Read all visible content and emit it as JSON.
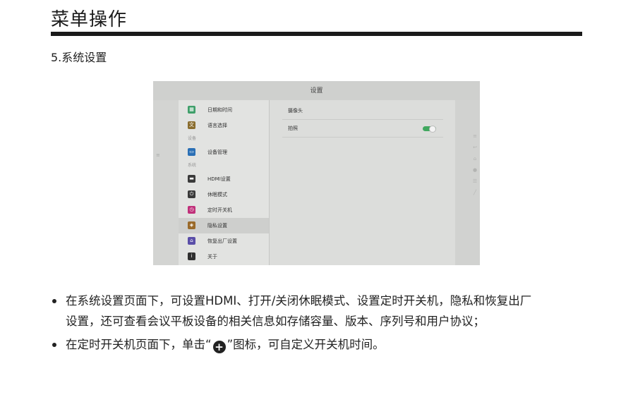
{
  "header": {
    "title": "菜单操作"
  },
  "section": {
    "title": "5.系统设置"
  },
  "screenshot": {
    "window_title": "设置",
    "menu": {
      "items": [
        {
          "label": "日期和时间",
          "icon": "calendar-icon",
          "color": "#3f9f6a"
        },
        {
          "label": "语言选择",
          "icon": "language-icon",
          "color": "#8a6d2e"
        },
        {
          "label": "设备管理",
          "icon": "monitor-icon",
          "color": "#2a6fb5"
        },
        {
          "label": "HDMI设置",
          "icon": "hdmi-icon",
          "color": "#3a3a3a"
        },
        {
          "label": "休眠模式",
          "icon": "power-icon",
          "color": "#3a3a3a"
        },
        {
          "label": "定时开关机",
          "icon": "timer-icon",
          "color": "#c0307a"
        },
        {
          "label": "隐私设置",
          "icon": "shield-icon",
          "color": "#9a6a2a"
        },
        {
          "label": "恢复出厂设置",
          "icon": "restore-icon",
          "color": "#5a4ea8"
        },
        {
          "label": "关于",
          "icon": "info-icon",
          "color": "#2f2f2f"
        }
      ],
      "groups": {
        "device": "设备",
        "system": "系统"
      },
      "active_index": 6
    },
    "content": {
      "rows": [
        {
          "label": "摄像头"
        },
        {
          "label": "拍照",
          "toggle": true
        }
      ]
    }
  },
  "bullets": {
    "item1_line1": "在系统设置页面下，可设置HDMI、打开/关闭休眠模式、设置定时开关机，隐私和恢复出厂",
    "item1_line2": "设置，还可查看会议平板设备的相关信息如存储容量、版本、序列号和用户协议；",
    "item2_before": "在定时开关机页面下，单击“",
    "item2_after": "”图标，可自定义开关机时间。"
  }
}
